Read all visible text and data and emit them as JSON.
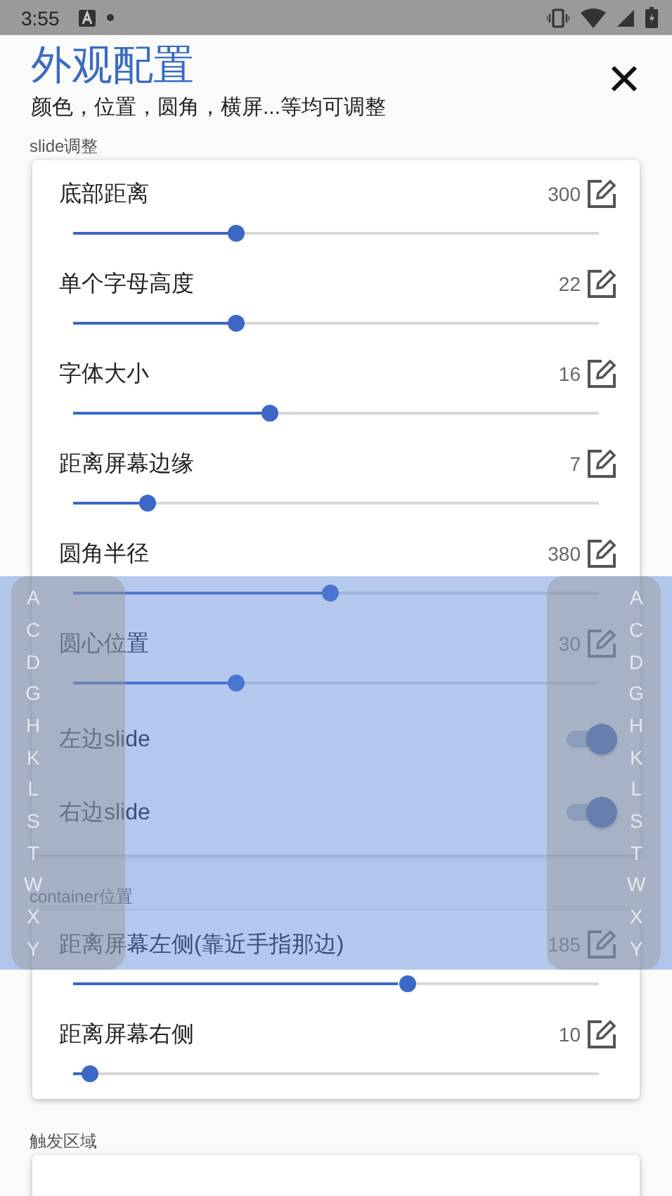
{
  "status_bar": {
    "time": "3:55"
  },
  "header": {
    "title": "外观配置",
    "subtitle": "颜色，位置，圆角，横屏...等均可调整"
  },
  "sections": [
    {
      "label": "slide调整",
      "rows": [
        {
          "kind": "slider",
          "label": "底部距离",
          "value": "300",
          "level": 0.3
        },
        {
          "kind": "slider",
          "label": "单个字母高度",
          "value": "22",
          "level": 0.3
        },
        {
          "kind": "slider",
          "label": "字体大小",
          "value": "16",
          "level": 0.363
        },
        {
          "kind": "slider",
          "label": "距离屏幕边缘",
          "value": "7",
          "level": 0.137
        },
        {
          "kind": "slider",
          "label": "圆角半径",
          "value": "380",
          "level": 0.474
        },
        {
          "kind": "slider",
          "label": "圆心位置",
          "value": "30",
          "level": 0.3
        },
        {
          "kind": "switch",
          "label": "左边slide",
          "on": true
        },
        {
          "kind": "switch",
          "label": "右边slide",
          "on": true
        }
      ]
    },
    {
      "label": "container位置",
      "rows": [
        {
          "kind": "slider",
          "label": "距离屏幕左侧(靠近手指那边)",
          "value": "185",
          "level": 0.617
        },
        {
          "kind": "slider",
          "label": "距离屏幕右侧",
          "value": "10",
          "level": 0.031
        }
      ]
    },
    {
      "label": "触发区域"
    }
  ],
  "index_bars": [
    {
      "letters": [
        "A",
        "C",
        "D",
        "G",
        "H",
        "K",
        "L",
        "S",
        "T",
        "W",
        "X",
        "Y"
      ]
    },
    {
      "letters": [
        "A",
        "C",
        "D",
        "G",
        "H",
        "K",
        "L",
        "S",
        "T",
        "W",
        "X",
        "Y"
      ]
    }
  ]
}
